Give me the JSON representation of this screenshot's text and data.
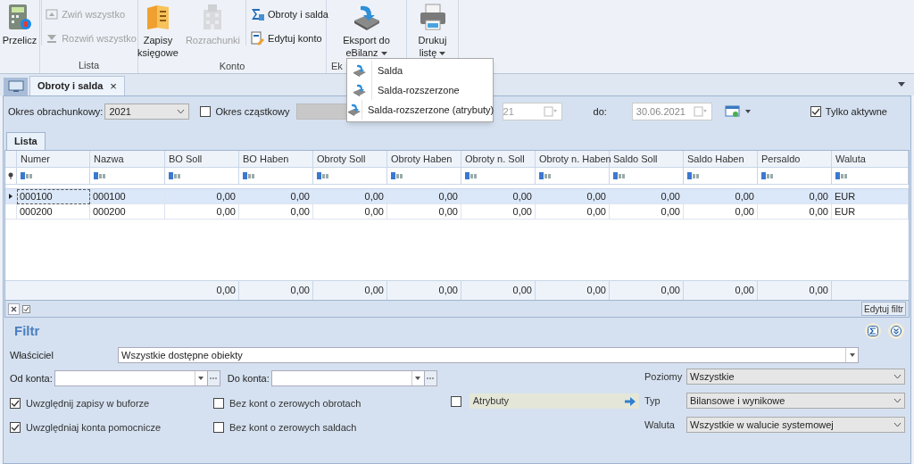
{
  "ribbon": {
    "groups": [
      {
        "items": [
          {
            "kind": "large",
            "label": "Przelicz",
            "disabled": false,
            "dropdown": false
          }
        ]
      },
      {
        "label": "Lista",
        "items": [
          {
            "kind": "small",
            "label": "Zwiń wszystko",
            "disabled": true
          },
          {
            "kind": "small",
            "label": "Rozwiń wszystko",
            "disabled": true
          }
        ]
      },
      {
        "label": "Konto",
        "items": [
          {
            "kind": "large",
            "label": "Zapisy księgowe",
            "disabled": false,
            "dropdown": false
          },
          {
            "kind": "large",
            "label": "Rozrachunki",
            "disabled": true,
            "dropdown": false
          },
          {
            "kind": "small",
            "label": "Obroty i salda",
            "disabled": false
          },
          {
            "kind": "small",
            "label": "Edytuj konto",
            "disabled": false
          }
        ]
      },
      {
        "label": "Ek",
        "items": [
          {
            "kind": "large",
            "label": "Eksport do eBilanz",
            "disabled": false,
            "dropdown": true
          }
        ]
      },
      {
        "items": [
          {
            "kind": "large",
            "label": "Drukuj listę",
            "disabled": false,
            "dropdown": true
          }
        ]
      }
    ]
  },
  "menu": {
    "items": [
      {
        "label": "Salda"
      },
      {
        "label": "Salda-rozszerzone"
      },
      {
        "label": "Salda-rozszerzone (atrybuty)"
      }
    ]
  },
  "tabs": [
    {
      "label": "Obroty i salda",
      "selected": true,
      "close": "×"
    }
  ],
  "period": {
    "label": "Okres obrachunkowy:",
    "value": "2021"
  },
  "partial": {
    "label": "Okres cząstkowy",
    "checked": false
  },
  "date_from": {
    "value": "21"
  },
  "date_to": {
    "label": "do:",
    "value": "30.06.2021"
  },
  "only_active": {
    "label": "Tylko aktywne",
    "checked": true
  },
  "list_tab": {
    "label": "Lista",
    "selected": true
  },
  "table": {
    "columns": [
      "Numer",
      "Nazwa",
      "BO Soll",
      "BO Haben",
      "Obroty Soll",
      "Obroty Haben",
      "Obroty n. Soll",
      "Obroty n. Haben",
      "Saldo Soll",
      "Saldo Haben",
      "Persaldo",
      "Waluta"
    ],
    "rows": [
      {
        "selected": true,
        "cells": [
          "000100",
          "000100",
          "0,00",
          "0,00",
          "0,00",
          "0,00",
          "0,00",
          "0,00",
          "0,00",
          "0,00",
          "0,00",
          "EUR"
        ]
      },
      {
        "selected": false,
        "cells": [
          "000200",
          "000200",
          "0,00",
          "0,00",
          "0,00",
          "0,00",
          "0,00",
          "0,00",
          "0,00",
          "0,00",
          "0,00",
          "EUR"
        ]
      }
    ],
    "totals": [
      "0,00",
      "0,00",
      "0,00",
      "0,00",
      "0,00",
      "0,00",
      "0,00",
      "0,00",
      "0,00"
    ]
  },
  "edit_filter": "Edytuj filtr",
  "filter": {
    "title": "Filtr",
    "owner": {
      "label": "Właściciel",
      "value": "Wszystkie dostępne obiekty"
    },
    "from_account": {
      "label": "Od konta:"
    },
    "to_account": {
      "label": "Do konta:"
    },
    "checks": [
      {
        "label": "Uwzględnij zapisy w buforze",
        "checked": true
      },
      {
        "label": "Bez kont o zerowych obrotach",
        "checked": false
      },
      {
        "label": "Uwzględniaj konta pomocnicze",
        "checked": true
      },
      {
        "label": "Bez kont o zerowych saldach",
        "checked": false
      }
    ],
    "attributes": {
      "label": "Atrybuty",
      "checked": false
    },
    "selects": [
      {
        "label": "Poziomy",
        "value": "Wszystkie"
      },
      {
        "label": "Typ",
        "value": "Bilansowe i wynikowe"
      },
      {
        "label": "Waluta",
        "value": "Wszystkie w walucie systemowej"
      }
    ]
  }
}
